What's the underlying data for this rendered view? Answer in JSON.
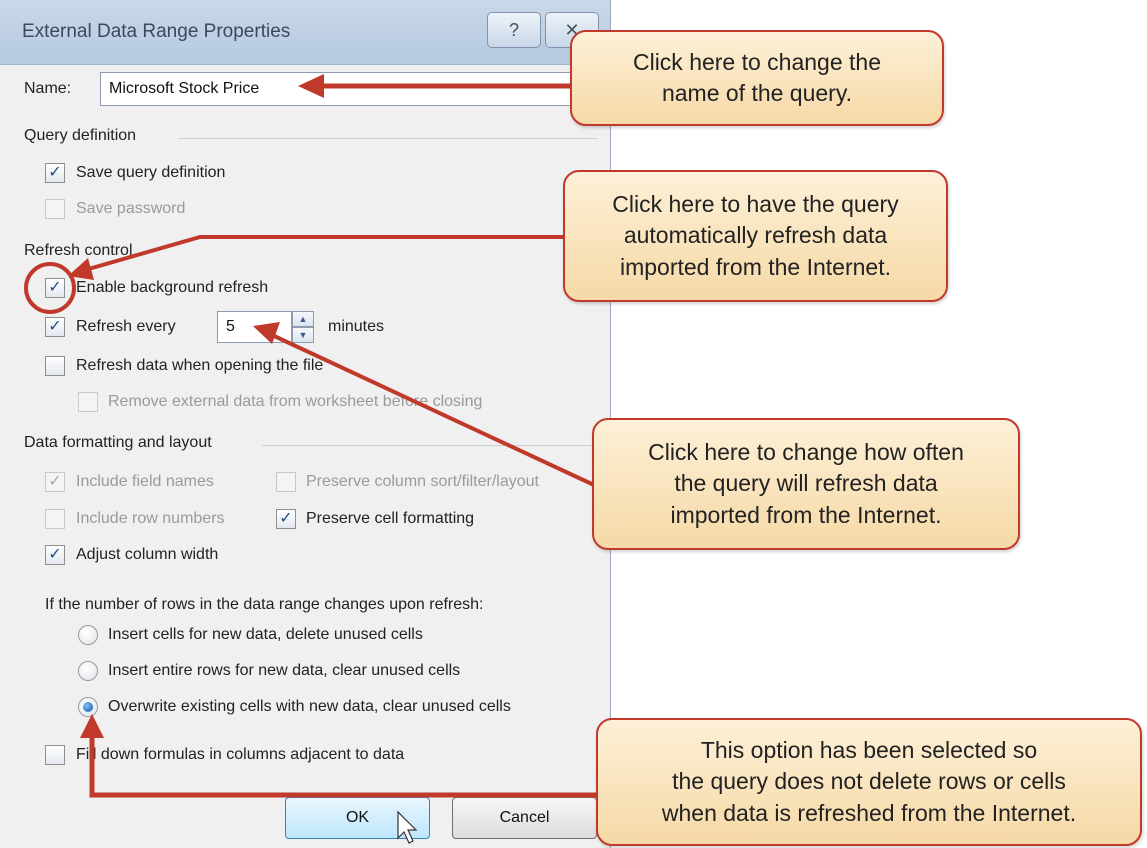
{
  "dialog": {
    "title": "External Data Range Properties",
    "help_glyph": "?",
    "close_glyph": "✕",
    "name_label": "Name:",
    "name_value": "Microsoft Stock Price"
  },
  "query_definition": {
    "heading": "Query definition",
    "save_query": {
      "label": "Save query definition",
      "checked": true
    },
    "save_password": {
      "label": "Save password",
      "checked": false,
      "disabled": true
    }
  },
  "refresh_control": {
    "heading": "Refresh control",
    "background_refresh": {
      "label": "Enable background refresh",
      "checked": true
    },
    "refresh_every": {
      "label": "Refresh every",
      "value": "5",
      "unit": "minutes",
      "checked": true
    },
    "refresh_on_open": {
      "label": "Refresh data when opening the file",
      "checked": false
    },
    "remove_external": {
      "label": "Remove external data from worksheet before closing",
      "checked": false,
      "disabled": true
    }
  },
  "formatting": {
    "heading": "Data formatting and layout",
    "include_field_names": {
      "label": "Include field names",
      "checked": true,
      "disabled": true
    },
    "preserve_sort": {
      "label": "Preserve column sort/filter/layout",
      "checked": false,
      "disabled": true
    },
    "include_row_numbers": {
      "label": "Include row numbers",
      "checked": false,
      "disabled": true
    },
    "preserve_cell_formatting": {
      "label": "Preserve cell formatting",
      "checked": true
    },
    "adjust_column_width": {
      "label": "Adjust column width",
      "checked": true
    }
  },
  "rows_change": {
    "question": "If the number of rows in the data range changes upon refresh:",
    "options": [
      {
        "label": "Insert cells for new data, delete unused cells",
        "selected": false
      },
      {
        "label": "Insert entire rows for new data, clear unused cells",
        "selected": false
      },
      {
        "label": "Overwrite existing cells with new data, clear unused cells",
        "selected": true
      }
    ]
  },
  "fill_down": {
    "label": "Fill down formulas in columns adjacent to data",
    "checked": false
  },
  "buttons": {
    "ok": "OK",
    "cancel": "Cancel"
  },
  "callouts": {
    "name": [
      "Click here to change the",
      "name of the query."
    ],
    "background": [
      "Click here to have the query",
      "automatically refresh data",
      "imported from the Internet."
    ],
    "frequency": [
      "Click here to change how often",
      "the query will refresh data",
      "imported from the Internet."
    ],
    "overwrite": [
      "This option has been selected so",
      "the query does not delete rows or cells",
      "when data is refreshed from the Internet."
    ]
  },
  "colors": {
    "arrow": "#c0392b",
    "callout_fill": "#f6d9a6",
    "checkmark": "#1f4e8a"
  }
}
